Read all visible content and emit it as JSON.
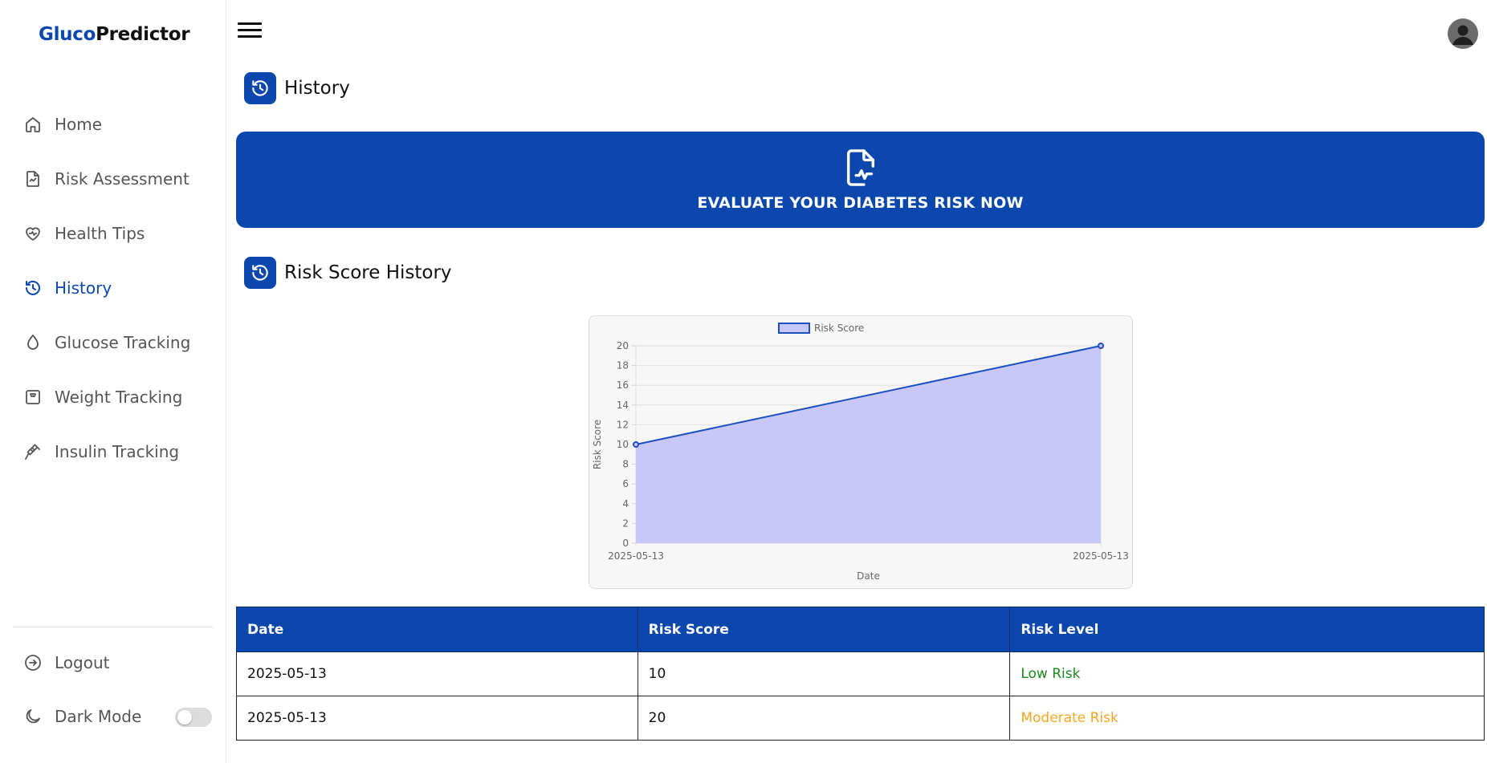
{
  "brand": {
    "part1": "Gluco",
    "part2": "Predictor"
  },
  "sidebar": {
    "items": [
      {
        "label": "Home",
        "icon": "home-icon"
      },
      {
        "label": "Risk Assessment",
        "icon": "chart-document-icon"
      },
      {
        "label": "Health Tips",
        "icon": "heart-pulse-icon"
      },
      {
        "label": "History",
        "icon": "history-icon",
        "active": true
      },
      {
        "label": "Glucose Tracking",
        "icon": "droplet-icon"
      },
      {
        "label": "Weight Tracking",
        "icon": "scale-icon"
      },
      {
        "label": "Insulin Tracking",
        "icon": "syringe-icon"
      }
    ],
    "logout_label": "Logout",
    "dark_mode_label": "Dark Mode",
    "dark_mode_on": false
  },
  "page": {
    "title": "History",
    "banner_label": "EVALUATE YOUR DIABETES RISK NOW",
    "section_title": "Risk Score History"
  },
  "colors": {
    "accent": "#0b47ad",
    "low_risk": "#1a8a1a",
    "moderate_risk": "#f5a623",
    "chart_fill": "#c7c8f7",
    "chart_line": "#1e4fbf"
  },
  "chart_data": {
    "type": "area",
    "x": [
      "2025-05-13",
      "2025-05-13"
    ],
    "series": [
      {
        "name": "Risk Score",
        "values": [
          10,
          20
        ]
      }
    ],
    "xlabel": "Date",
    "ylabel": "Risk Score",
    "ylim": [
      0,
      20
    ],
    "yticks": [
      0,
      2,
      4,
      6,
      8,
      10,
      12,
      14,
      16,
      18,
      20
    ],
    "legend": "top-center",
    "grid": true
  },
  "table": {
    "headers": [
      "Date",
      "Risk Score",
      "Risk Level"
    ],
    "rows": [
      {
        "date": "2025-05-13",
        "score": "10",
        "level": "Low Risk",
        "level_color": "#1a8a1a"
      },
      {
        "date": "2025-05-13",
        "score": "20",
        "level": "Moderate Risk",
        "level_color": "#f5a623"
      }
    ]
  }
}
